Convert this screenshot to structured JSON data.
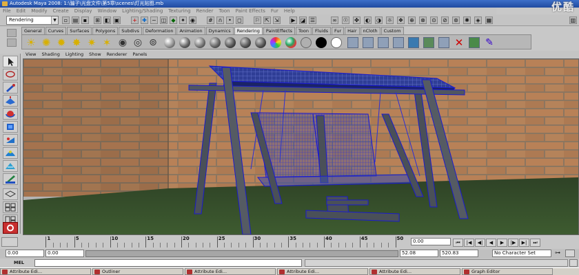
{
  "window": {
    "title": "Autodesk Maya 2008: 1:\\骗子\\光盘文件\\第5章\\scenes\\灯光贴图.mb",
    "watermark": "优酷"
  },
  "menubar": [
    "File",
    "Edit",
    "Modify",
    "Create",
    "Display",
    "Window",
    "Lighting/Shading",
    "Texturing",
    "Render",
    "Toon",
    "Paint Effects",
    "Fur",
    "Help"
  ],
  "statusline": {
    "mode": "Rendering"
  },
  "shelf_tabs": [
    "General",
    "Curves",
    "Surfaces",
    "Polygons",
    "Subdivs",
    "Deformation",
    "Animation",
    "Dynamics",
    "Rendering",
    "PaintEffects",
    "Toon",
    "Fluids",
    "Fur",
    "Hair",
    "nCloth",
    "Custom"
  ],
  "active_shelf_tab": "Rendering",
  "panel_menu": [
    "View",
    "Shading",
    "Lighting",
    "Show",
    "Renderer",
    "Panels"
  ],
  "timeslider": {
    "labels": [
      "1",
      "5",
      "10",
      "15",
      "20",
      "25",
      "30",
      "35",
      "40",
      "45",
      "50"
    ],
    "current_time": "0.00"
  },
  "rangeslider": {
    "start_time": "0.00",
    "playback_start": "0.00",
    "playback_end": "52.08",
    "end_time": "520.83",
    "character_set": "No Character Set"
  },
  "cmdline": {
    "label": "MEL"
  },
  "taskbar": [
    "Attribute Edi...",
    "Outliner",
    "Attribute Edi...",
    "Attribute Edi...",
    "Attribute Edi...",
    "Graph Editor"
  ],
  "colors": {
    "title_bar": "#2350a8",
    "wireframe": "#2b2ed6",
    "brick": "#b07a52",
    "mortar": "#8f7860",
    "grass": "#3c5a2e"
  }
}
